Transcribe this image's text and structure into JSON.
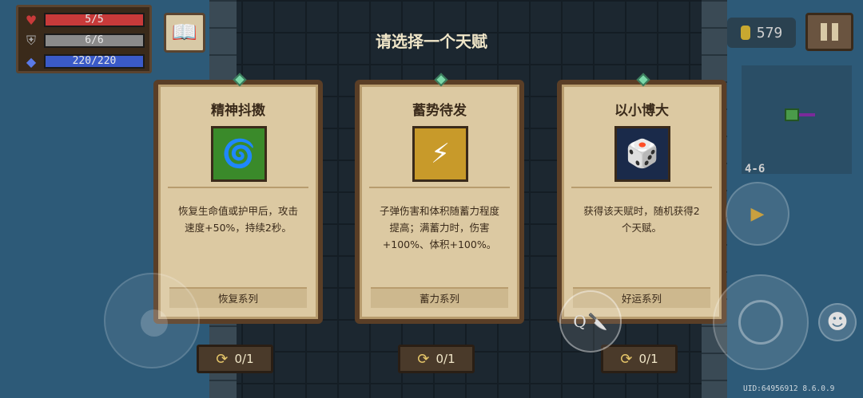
{
  "hud": {
    "hp": {
      "text": "5/5",
      "fill": 1.0,
      "color": "#c83a3a",
      "icon": "heart-icon"
    },
    "armor": {
      "text": "6/6",
      "fill": 1.0,
      "color": "#8a8a8a",
      "icon": "shield-icon"
    },
    "energy": {
      "text": "220/220",
      "fill": 1.0,
      "color": "#3a5ac8",
      "icon": "diamond-icon"
    },
    "coins": "579",
    "level": "4-6"
  },
  "title": "请选择一个天赋",
  "cards": [
    {
      "name": "精神抖擞",
      "icon": "swirl-character-icon",
      "bg": "#3a8a2a",
      "desc": "恢复生命值或护甲后，攻击速度+50%，持续2秒。",
      "series": "恢复系列",
      "reroll": "0/1"
    },
    {
      "name": "蓄势待发",
      "icon": "bullet-charge-icon",
      "bg": "#c89a2a",
      "desc": "子弹伤害和体积随蓄力程度提高；满蓄力时，伤害+100%、体积+100%。",
      "series": "蓄力系列",
      "reroll": "0/1"
    },
    {
      "name": "以小博大",
      "icon": "dice-icon",
      "bg": "#1a2a4a",
      "desc": "获得该天赋时，随机获得2个天赋。",
      "series": "好运系列",
      "reroll": "0/1"
    }
  ],
  "skill_key": "Q",
  "uid": "UID:64956912 8.6.0.9"
}
